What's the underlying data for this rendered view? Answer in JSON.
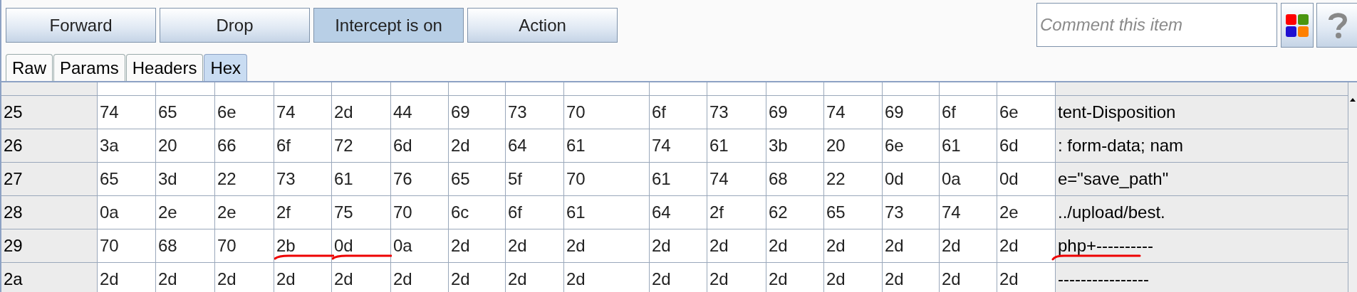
{
  "toolbar": {
    "buttons": [
      {
        "label": "Forward",
        "selected": false
      },
      {
        "label": "Drop",
        "selected": false
      },
      {
        "label": "Intercept is on",
        "selected": true
      },
      {
        "label": "Action",
        "selected": false
      }
    ]
  },
  "comment": {
    "placeholder": "Comment this item"
  },
  "tabs": [
    {
      "label": "Raw",
      "selected": false
    },
    {
      "label": "Params",
      "selected": false
    },
    {
      "label": "Headers",
      "selected": false
    },
    {
      "label": "Hex",
      "selected": true
    }
  ],
  "hex_rows": [
    {
      "address": "25",
      "bytes": [
        "74",
        "65",
        "6e",
        "74",
        "2d",
        "44",
        "69",
        "73",
        "70",
        "6f",
        "73",
        "69",
        "74",
        "69",
        "6f",
        "6e"
      ],
      "ascii": "tent-Disposition"
    },
    {
      "address": "26",
      "bytes": [
        "3a",
        "20",
        "66",
        "6f",
        "72",
        "6d",
        "2d",
        "64",
        "61",
        "74",
        "61",
        "3b",
        "20",
        "6e",
        "61",
        "6d"
      ],
      "ascii": ": form-data; nam"
    },
    {
      "address": "27",
      "bytes": [
        "65",
        "3d",
        "22",
        "73",
        "61",
        "76",
        "65",
        "5f",
        "70",
        "61",
        "74",
        "68",
        "22",
        "0d",
        "0a",
        "0d"
      ],
      "ascii": "e=\"save_path\""
    },
    {
      "address": "28",
      "bytes": [
        "0a",
        "2e",
        "2e",
        "2f",
        "75",
        "70",
        "6c",
        "6f",
        "61",
        "64",
        "2f",
        "62",
        "65",
        "73",
        "74",
        "2e"
      ],
      "ascii": "../upload/best."
    },
    {
      "address": "29",
      "bytes": [
        "70",
        "68",
        "70",
        "2b",
        "0d",
        "0a",
        "2d",
        "2d",
        "2d",
        "2d",
        "2d",
        "2d",
        "2d",
        "2d",
        "2d",
        "2d"
      ],
      "ascii": "php+----------",
      "marked_bytes": [
        false,
        false,
        false,
        true,
        true,
        false,
        false,
        false,
        false,
        false,
        false,
        false,
        false,
        false,
        false,
        false
      ],
      "ascii_marked": true
    },
    {
      "address": "2a",
      "bytes": [
        "2d",
        "2d",
        "2d",
        "2d",
        "2d",
        "2d",
        "2d",
        "2d",
        "2d",
        "2d",
        "2d",
        "2d",
        "2d",
        "2d",
        "2d",
        "2d"
      ],
      "ascii": "----------------"
    }
  ]
}
